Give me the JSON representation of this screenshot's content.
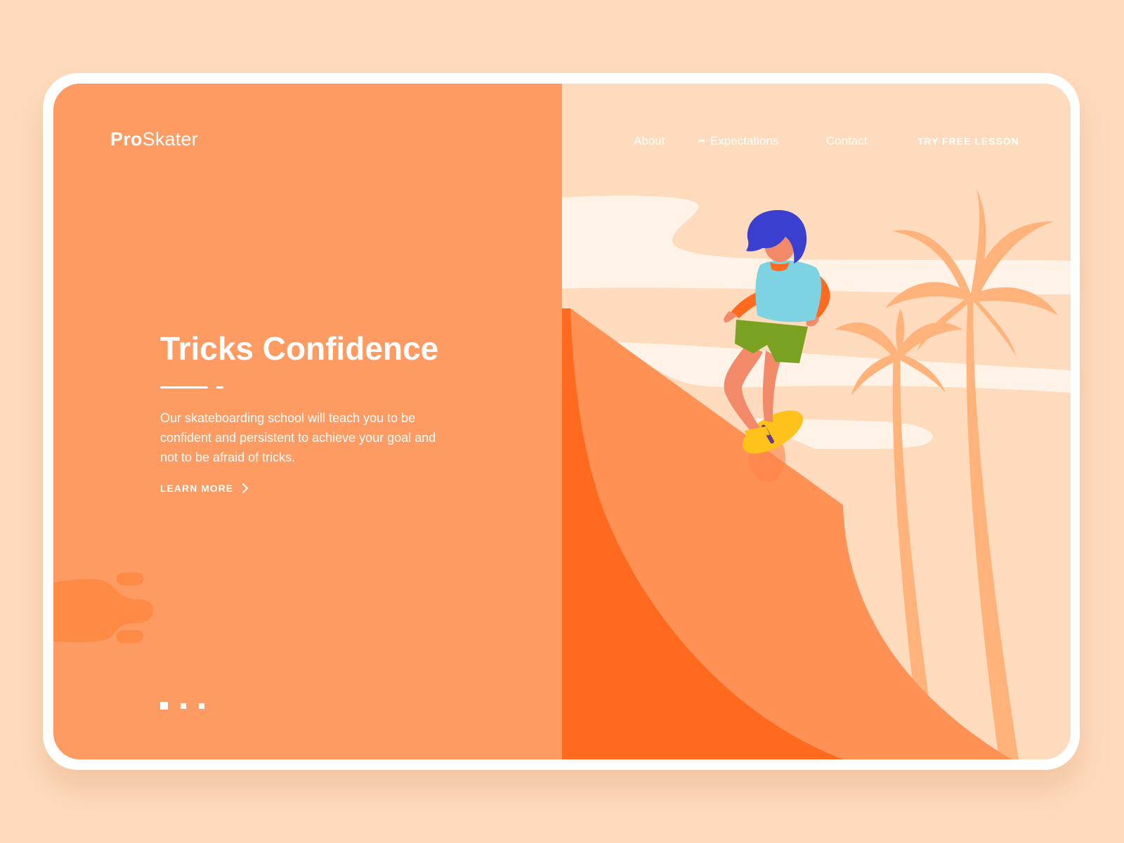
{
  "brand": {
    "bold": "Pro",
    "light": "Skater"
  },
  "nav": {
    "about": "About",
    "expectations": "Expectations",
    "contact": "Contact",
    "cta": "TRY FREE LESSON"
  },
  "hero": {
    "title": "Tricks Confidence",
    "description": "Our skateboarding school will teach you to be confident and persistent to achieve your goal and not to be afraid of tricks.",
    "learn_more": "LEARN MORE"
  },
  "pager": {
    "count": 3,
    "active_index": 0
  },
  "colors": {
    "page_background": "#fedbbd",
    "panel_orange": "#fe9b62",
    "ramp_dark": "#ff6a1f",
    "ramp_mid": "#ff9155",
    "sky_cream": "#fff3e8",
    "palm": "#ffb27a",
    "hair": "#3a3fcf",
    "shirt": "#7ed3e2",
    "shorts": "#7aa11f",
    "board": "#ffc21a"
  }
}
